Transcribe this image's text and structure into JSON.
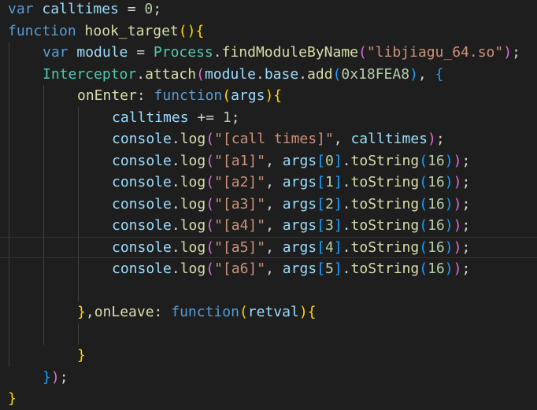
{
  "colors": {
    "background": "#1e1e1e",
    "keyword": "#569cd6",
    "variable": "#9cdcfe",
    "class": "#4ec9b0",
    "function": "#dcdcaa",
    "string": "#ce9178",
    "number": "#b5cea8",
    "bracket_level_1": "#ffd700",
    "bracket_level_2": "#da70d6",
    "bracket_level_3": "#179fff"
  },
  "code": {
    "lines": [
      {
        "indent": 0,
        "tokens": [
          [
            "kw",
            "var"
          ],
          [
            "op",
            " "
          ],
          [
            "var",
            "calltimes"
          ],
          [
            "op",
            " = "
          ],
          [
            "num",
            "0"
          ],
          [
            "op",
            ";"
          ]
        ]
      },
      {
        "indent": 0,
        "tokens": [
          [
            "kw",
            "function"
          ],
          [
            "op",
            " "
          ],
          [
            "fn",
            "hook_target"
          ],
          [
            "b1",
            "()"
          ],
          [
            "b1",
            "{"
          ]
        ]
      },
      {
        "indent": 1,
        "tokens": [
          [
            "kw",
            "var"
          ],
          [
            "op",
            " "
          ],
          [
            "var",
            "module"
          ],
          [
            "op",
            " = "
          ],
          [
            "cls",
            "Process"
          ],
          [
            "op",
            "."
          ],
          [
            "fn",
            "findModuleByName"
          ],
          [
            "b2",
            "("
          ],
          [
            "str",
            "\"libjiagu_64.so\""
          ],
          [
            "b2",
            ")"
          ],
          [
            "op",
            ";"
          ]
        ]
      },
      {
        "indent": 1,
        "tokens": [
          [
            "cls",
            "Interceptor"
          ],
          [
            "op",
            "."
          ],
          [
            "fn",
            "attach"
          ],
          [
            "b2",
            "("
          ],
          [
            "var",
            "module"
          ],
          [
            "op",
            "."
          ],
          [
            "var",
            "base"
          ],
          [
            "op",
            "."
          ],
          [
            "fn",
            "add"
          ],
          [
            "b3",
            "("
          ],
          [
            "num",
            "0x18FEA8"
          ],
          [
            "b3",
            ")"
          ],
          [
            "op",
            ", "
          ],
          [
            "b3",
            "{"
          ]
        ]
      },
      {
        "indent": 2,
        "tokens": [
          [
            "fn",
            "onEnter"
          ],
          [
            "op",
            ": "
          ],
          [
            "kw",
            "function"
          ],
          [
            "b1",
            "("
          ],
          [
            "var",
            "args"
          ],
          [
            "b1",
            ")"
          ],
          [
            "b1",
            "{"
          ]
        ]
      },
      {
        "indent": 3,
        "tokens": [
          [
            "var",
            "calltimes"
          ],
          [
            "op",
            " += "
          ],
          [
            "num",
            "1"
          ],
          [
            "op",
            ";"
          ]
        ]
      },
      {
        "indent": 3,
        "tokens": [
          [
            "var",
            "console"
          ],
          [
            "op",
            "."
          ],
          [
            "fn",
            "log"
          ],
          [
            "b2",
            "("
          ],
          [
            "str",
            "\"[call times]\""
          ],
          [
            "op",
            ", "
          ],
          [
            "var",
            "calltimes"
          ],
          [
            "b2",
            ")"
          ],
          [
            "op",
            ";"
          ]
        ]
      },
      {
        "indent": 3,
        "tokens": [
          [
            "var",
            "console"
          ],
          [
            "op",
            "."
          ],
          [
            "fn",
            "log"
          ],
          [
            "b2",
            "("
          ],
          [
            "str",
            "\"[a1]\""
          ],
          [
            "op",
            ", "
          ],
          [
            "var",
            "args"
          ],
          [
            "b3",
            "["
          ],
          [
            "num",
            "0"
          ],
          [
            "b3",
            "]"
          ],
          [
            "op",
            "."
          ],
          [
            "fn",
            "toString"
          ],
          [
            "b3",
            "("
          ],
          [
            "num",
            "16"
          ],
          [
            "b3",
            ")"
          ],
          [
            "b2",
            ")"
          ],
          [
            "op",
            ";"
          ]
        ]
      },
      {
        "indent": 3,
        "tokens": [
          [
            "var",
            "console"
          ],
          [
            "op",
            "."
          ],
          [
            "fn",
            "log"
          ],
          [
            "b2",
            "("
          ],
          [
            "str",
            "\"[a2]\""
          ],
          [
            "op",
            ", "
          ],
          [
            "var",
            "args"
          ],
          [
            "b3",
            "["
          ],
          [
            "num",
            "1"
          ],
          [
            "b3",
            "]"
          ],
          [
            "op",
            "."
          ],
          [
            "fn",
            "toString"
          ],
          [
            "b3",
            "("
          ],
          [
            "num",
            "16"
          ],
          [
            "b3",
            ")"
          ],
          [
            "b2",
            ")"
          ],
          [
            "op",
            ";"
          ]
        ]
      },
      {
        "indent": 3,
        "tokens": [
          [
            "var",
            "console"
          ],
          [
            "op",
            "."
          ],
          [
            "fn",
            "log"
          ],
          [
            "b2",
            "("
          ],
          [
            "str",
            "\"[a3]\""
          ],
          [
            "op",
            ", "
          ],
          [
            "var",
            "args"
          ],
          [
            "b3",
            "["
          ],
          [
            "num",
            "2"
          ],
          [
            "b3",
            "]"
          ],
          [
            "op",
            "."
          ],
          [
            "fn",
            "toString"
          ],
          [
            "b3",
            "("
          ],
          [
            "num",
            "16"
          ],
          [
            "b3",
            ")"
          ],
          [
            "b2",
            ")"
          ],
          [
            "op",
            ";"
          ]
        ]
      },
      {
        "indent": 3,
        "tokens": [
          [
            "var",
            "console"
          ],
          [
            "op",
            "."
          ],
          [
            "fn",
            "log"
          ],
          [
            "b2",
            "("
          ],
          [
            "str",
            "\"[a4]\""
          ],
          [
            "op",
            ", "
          ],
          [
            "var",
            "args"
          ],
          [
            "b3",
            "["
          ],
          [
            "num",
            "3"
          ],
          [
            "b3",
            "]"
          ],
          [
            "op",
            "."
          ],
          [
            "fn",
            "toString"
          ],
          [
            "b3",
            "("
          ],
          [
            "num",
            "16"
          ],
          [
            "b3",
            ")"
          ],
          [
            "b2",
            ")"
          ],
          [
            "op",
            ";"
          ]
        ]
      },
      {
        "indent": 3,
        "tokens": [
          [
            "var",
            "console"
          ],
          [
            "op",
            "."
          ],
          [
            "fn",
            "log"
          ],
          [
            "b2",
            "("
          ],
          [
            "str",
            "\"[a5]\""
          ],
          [
            "op",
            ", "
          ],
          [
            "var",
            "args"
          ],
          [
            "b3",
            "["
          ],
          [
            "num",
            "4"
          ],
          [
            "b3",
            "]"
          ],
          [
            "op",
            "."
          ],
          [
            "fn",
            "toString"
          ],
          [
            "b3",
            "("
          ],
          [
            "num",
            "16"
          ],
          [
            "b3",
            ")"
          ],
          [
            "b2",
            ")"
          ],
          [
            "op",
            ";"
          ]
        ]
      },
      {
        "indent": 3,
        "tokens": [
          [
            "var",
            "console"
          ],
          [
            "op",
            "."
          ],
          [
            "fn",
            "log"
          ],
          [
            "b2",
            "("
          ],
          [
            "str",
            "\"[a6]\""
          ],
          [
            "op",
            ", "
          ],
          [
            "var",
            "args"
          ],
          [
            "b3",
            "["
          ],
          [
            "num",
            "5"
          ],
          [
            "b3",
            "]"
          ],
          [
            "op",
            "."
          ],
          [
            "fn",
            "toString"
          ],
          [
            "b3",
            "("
          ],
          [
            "num",
            "16"
          ],
          [
            "b3",
            ")"
          ],
          [
            "b2",
            ")"
          ],
          [
            "op",
            ";"
          ]
        ]
      },
      {
        "indent": 0,
        "tokens": []
      },
      {
        "indent": 2,
        "tokens": [
          [
            "b1",
            "}"
          ],
          [
            "op",
            ","
          ],
          [
            "fn",
            "onLeave"
          ],
          [
            "op",
            ": "
          ],
          [
            "kw",
            "function"
          ],
          [
            "b1",
            "("
          ],
          [
            "var",
            "retval"
          ],
          [
            "b1",
            ")"
          ],
          [
            "b1",
            "{"
          ]
        ]
      },
      {
        "indent": 0,
        "tokens": []
      },
      {
        "indent": 2,
        "tokens": [
          [
            "b1",
            "}"
          ]
        ]
      },
      {
        "indent": 1,
        "tokens": [
          [
            "b3",
            "}"
          ],
          [
            "b2",
            ")"
          ],
          [
            "op",
            ";"
          ]
        ]
      },
      {
        "indent": 0,
        "tokens": [
          [
            "b1",
            "}"
          ]
        ]
      }
    ]
  }
}
